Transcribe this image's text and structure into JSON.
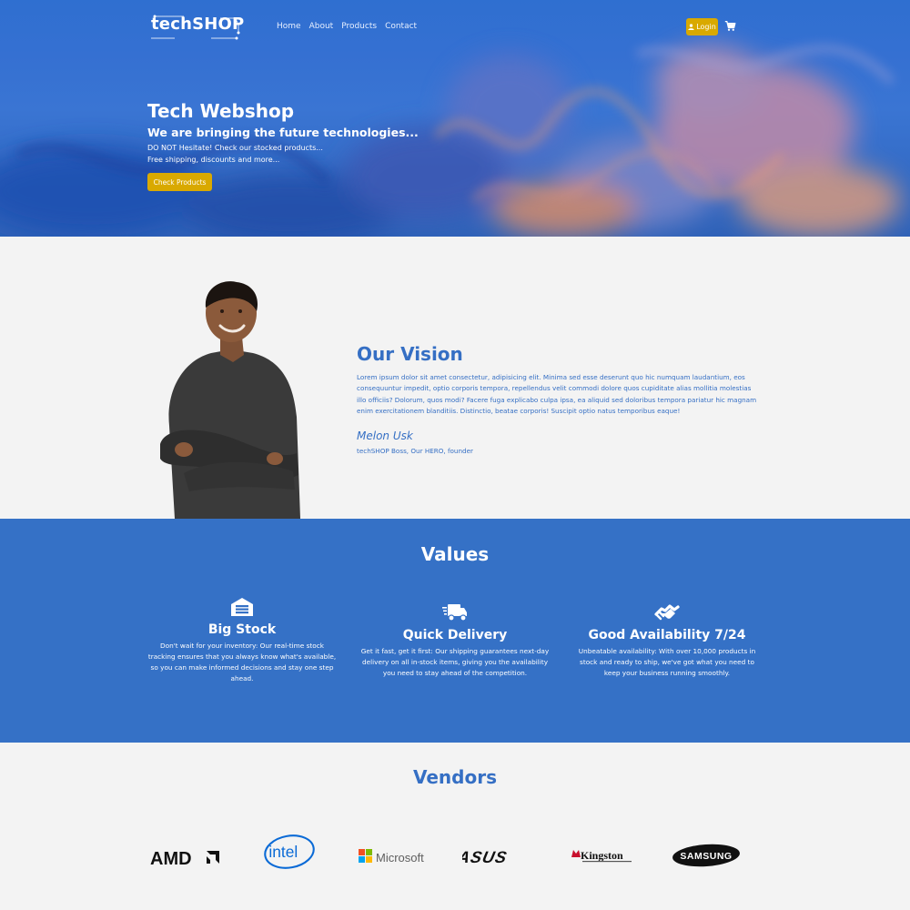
{
  "brand": {
    "logo_text": "techSHOP"
  },
  "nav": {
    "links": [
      "Home",
      "About",
      "Products",
      "Contact"
    ],
    "login_label": "Login",
    "login_icon": "user-icon",
    "cart_icon": "cart-icon"
  },
  "hero": {
    "title": "Tech Webshop",
    "subtitle": "We are bringing the future technologies...",
    "line1": "DO NOT Hesitate! Check our stocked products...",
    "line2": "Free shipping, discounts and more...",
    "button_label": "Check Products"
  },
  "vision": {
    "title": "Our Vision",
    "text": "Lorem ipsum dolor sit amet consectetur, adipisicing elit. Minima sed esse deserunt quo hic numquam laudantium, eos consequuntur impedit, optio corporis tempora, repellendus velit commodi dolore quos cupiditate alias mollitia molestias illo officiis? Dolorum, quos modi? Facere fuga explicabo culpa ipsa, ea aliquid sed doloribus tempora pariatur hic magnam enim exercitationem blanditiis. Distinctio, beatae corporis! Suscipit optio natus temporibus eaque!",
    "name": "Melon Usk",
    "role": "techSHOP Boss, Our HERO, founder"
  },
  "values": {
    "title": "Values",
    "items": [
      {
        "icon": "warehouse-icon",
        "name": "Big Stock",
        "desc": "Don't wait for your inventory: Our real-time stock tracking ensures that you always know what's available, so you can make informed decisions and stay one step ahead."
      },
      {
        "icon": "delivery-truck-icon",
        "name": "Quick Delivery",
        "desc": "Get it fast, get it first: Our shipping guarantees next-day delivery on all in-stock items, giving you the availability you need to stay ahead of the competition."
      },
      {
        "icon": "handshake-icon",
        "name": "Good Availability 7/24",
        "desc": "Unbeatable availability: With over 10,000 products in stock and ready to ship, we've got what you need to keep your business running smoothly."
      }
    ]
  },
  "vendors": {
    "title": "Vendors",
    "logos": [
      "AMD",
      "intel",
      "Microsoft",
      "ASUS",
      "Kingston",
      "SAMSUNG"
    ]
  },
  "colors": {
    "primary": "#3571c6",
    "accent": "#d9a900",
    "light_bg": "#f3f3f3"
  }
}
